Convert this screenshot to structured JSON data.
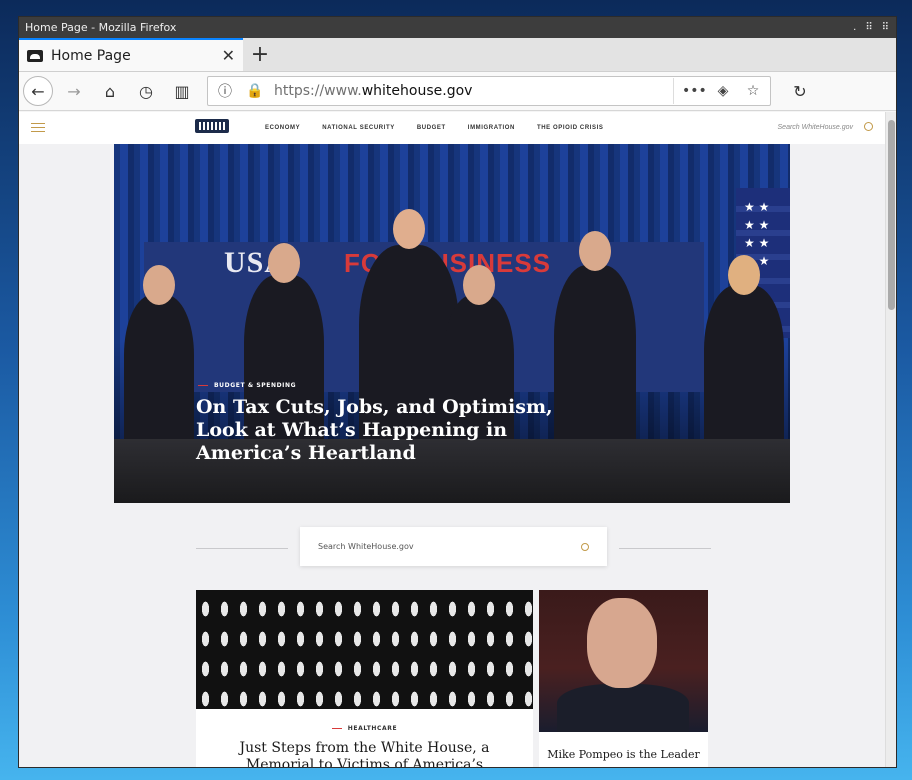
{
  "window": {
    "title": "Home Page - Mozilla Firefox"
  },
  "browser": {
    "tab_label": "Home Page",
    "url_prefix": "https://www.",
    "url_domain": "whitehouse.gov"
  },
  "site": {
    "menu": [
      "ECONOMY",
      "NATIONAL SECURITY",
      "BUDGET",
      "IMMIGRATION",
      "THE OPIOID CRISIS"
    ],
    "search_placeholder": "Search WhiteHouse.gov",
    "hero": {
      "tag": "BUDGET & SPENDING",
      "headline": "On Tax Cuts, Jobs, and Optimism, Look at What’s Happening in America’s Heartland",
      "banner_usa": "USA",
      "banner_business": "FOR BUSINESS"
    },
    "search2_placeholder": "Search WhiteHouse.gov",
    "cards": [
      {
        "tag": "HEALTHCARE",
        "title": "Just Steps from the White House, a Memorial to Victims of America’s"
      },
      {
        "title": "Mike Pompeo is the Leader"
      }
    ]
  }
}
